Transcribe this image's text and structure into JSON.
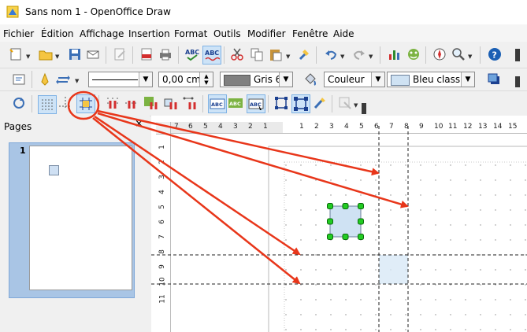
{
  "window": {
    "title": "Sans nom 1 - OpenOffice Draw"
  },
  "menu": [
    "Fichier",
    "Édition",
    "Affichage",
    "Insertion",
    "Format",
    "Outils",
    "Modifier",
    "Fenêtre",
    "Aide"
  ],
  "line_toolbar": {
    "line_width": "0,00 cm",
    "line_color": "Gris 6",
    "area_style": "Couleur",
    "area_color": "Bleu classic"
  },
  "pages_panel": {
    "title": "Pages",
    "close": "×",
    "page_number": "1"
  },
  "ruler": {
    "h_labels": [
      "7",
      "6",
      "5",
      "4",
      "3",
      "2",
      "1",
      "1",
      "2",
      "3",
      "4",
      "5",
      "6",
      "7",
      "8",
      "9",
      "10",
      "11",
      "12",
      "13",
      "14",
      "15"
    ],
    "v_labels": [
      "1",
      "2",
      "3",
      "4",
      "5",
      "6",
      "7",
      "8",
      "9",
      "10",
      "11"
    ]
  },
  "colors": {
    "accent_arrow": "#e8361a",
    "selection_handle": "#22cc22",
    "shape_fill": "#cfe2f3",
    "page_selected": "#a9c5e5"
  },
  "icons": [
    "new-document-icon",
    "open-icon",
    "save-icon",
    "mail-icon",
    "edit-icon",
    "pdf-icon",
    "print-icon",
    "spellcheck-icon",
    "autospell-icon",
    "cut-icon",
    "copy-icon",
    "paste-icon",
    "clone-format-icon",
    "undo-icon",
    "redo-icon",
    "chart-icon",
    "gallery-icon",
    "navigator-icon",
    "zoom-icon",
    "help-icon"
  ]
}
